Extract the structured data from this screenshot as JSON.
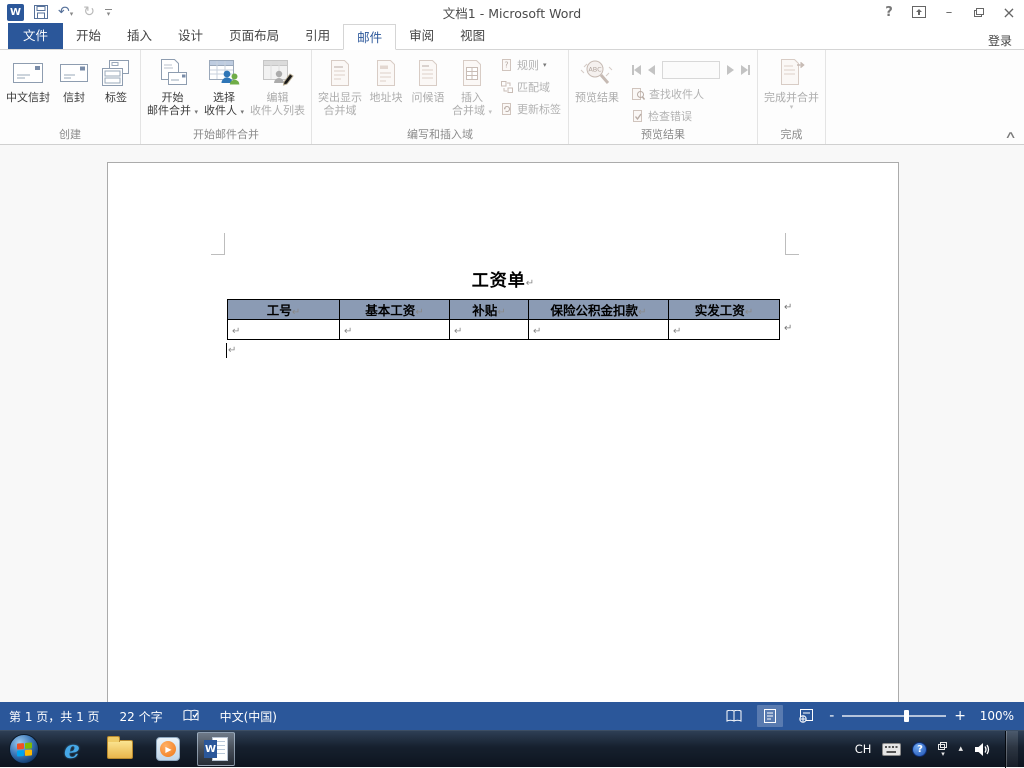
{
  "icons": {
    "dropdown_arrow": "▾",
    "undo": "↶",
    "redo": "↻",
    "help": "?",
    "minimize": "–",
    "close": "×",
    "ribbon_collapse": "∧",
    "tray_expand": "▴",
    "zoom_minus": "-",
    "zoom_plus": "+",
    "wmp_play": "▶",
    "word_w": "W"
  },
  "titlebar": {
    "title": "文档1 - Microsoft Word",
    "signin": "登录"
  },
  "tabs": {
    "file": "文件",
    "home": "开始",
    "insert": "插入",
    "design": "设计",
    "page_layout": "页面布局",
    "references": "引用",
    "mailings": "邮件",
    "review": "审阅",
    "view": "视图"
  },
  "ribbon": {
    "create": {
      "name": "创建",
      "chinese_envelope": "中文信封",
      "envelope": "信封",
      "labels": "标签"
    },
    "start_merge": {
      "name": "开始邮件合并",
      "start1": "开始",
      "start2": "邮件合并",
      "select1": "选择",
      "select2": "收件人",
      "edit1": "编辑",
      "edit2": "收件人列表"
    },
    "write_insert": {
      "name": "编写和插入域",
      "highlight1": "突出显示",
      "highlight2": "合并域",
      "address": "地址块",
      "greeting": "问候语",
      "insert1": "插入",
      "insert2": "合并域",
      "rules": "规则",
      "match": "匹配域",
      "update": "更新标签"
    },
    "preview": {
      "name": "预览结果",
      "preview_results": "预览结果",
      "find": "查找收件人",
      "check": "检查错误"
    },
    "finish": {
      "name": "完成",
      "finish_merge": "完成并合并"
    }
  },
  "document": {
    "title": "工资单",
    "pilcrow": "↵",
    "table": {
      "headers": [
        "工号",
        "基本工资",
        "补贴",
        "保险公积金扣款",
        "实发工资"
      ],
      "empty_row": [
        "",
        "",
        "",
        "",
        ""
      ]
    }
  },
  "statusbar": {
    "page_info": "第 1 页，共 1 页",
    "word_count": "22 个字",
    "language": "中文(中国)",
    "zoom_level": "100%"
  },
  "taskbar": {
    "tray_language": "CH"
  }
}
